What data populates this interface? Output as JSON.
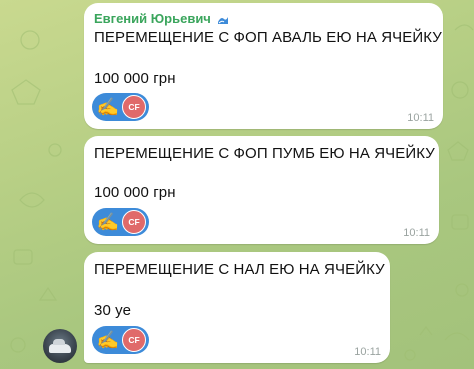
{
  "messages": [
    {
      "sender": "Евгений Юрьевич",
      "title": "ПЕРЕМЕЩЕНИЕ С ФОП АВАЛЬ ЕЮ НА ЯЧЕЙКУ",
      "amount": "100 000 грн",
      "reaction_emoji": "✍",
      "reaction_avatar_initials": "CF",
      "time": "10:11"
    },
    {
      "title": "ПЕРЕМЕЩЕНИЕ С ФОП ПУМБ ЕЮ НА ЯЧЕЙКУ",
      "amount": "100 000 грн",
      "reaction_emoji": "✍",
      "reaction_avatar_initials": "CF",
      "time": "10:11"
    },
    {
      "title": "ПЕРЕМЕЩЕНИЕ С НАЛ ЕЮ НА ЯЧЕЙКУ",
      "amount": "30 уе",
      "reaction_emoji": "✍",
      "reaction_avatar_initials": "CF",
      "time": "10:11"
    }
  ],
  "colors": {
    "sender_name": "#3aa55c",
    "reaction_chip": "#3d8bd9",
    "reaction_avatar": "#e06a6a",
    "timestamp": "#9aa3a0"
  },
  "icons": {
    "sender_badge": "wave-badge-icon",
    "user_avatar": "car-avatar"
  }
}
